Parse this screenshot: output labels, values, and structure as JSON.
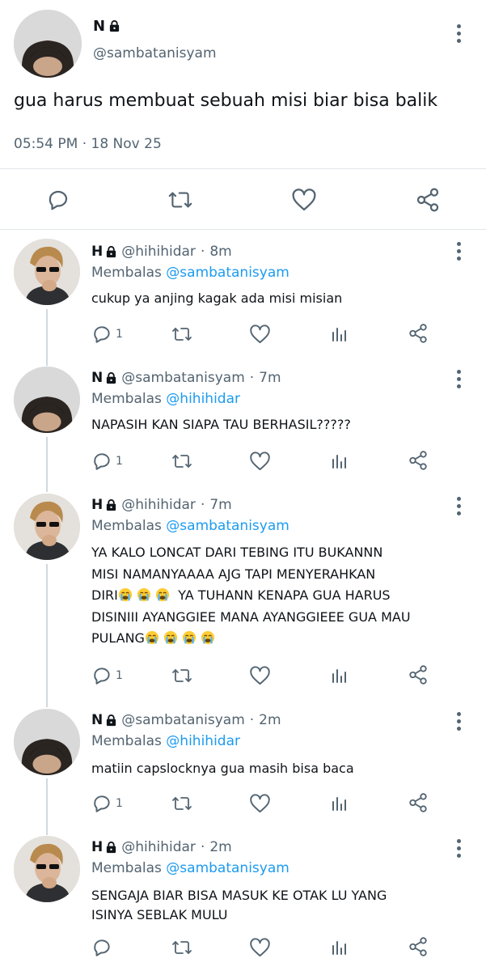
{
  "main": {
    "name": "N",
    "handle": "@sambatanisyam",
    "text": "gua harus membuat sebuah misi biar bisa balik",
    "timestamp": "05:54 PM · 18 Nov 25"
  },
  "replies": [
    {
      "name": "H",
      "handle": "@hihihidar",
      "time": "8m",
      "replying_label": "Membalas ",
      "replying_to": "@sambatanisyam",
      "text": "cukup ya anjing kagak ada misi misian",
      "reply_count": "1"
    },
    {
      "name": "N",
      "handle": "@sambatanisyam",
      "time": "7m",
      "replying_label": "Membalas ",
      "replying_to": "@hihihidar",
      "text": "NAPASIH KAN SIAPA TAU BERHASIL?????",
      "reply_count": "1"
    },
    {
      "name": "H",
      "handle": "@hihihidar",
      "time": "7m",
      "replying_label": "Membalas ",
      "replying_to": "@sambatanisyam",
      "text_lines": [
        "YA KALO LONCAT DARI TEBING ITU BUKANNN",
        "MISI NAMANYAAAA AJG TAPI MENYERAHKAN",
        "DIRI",
        "  YA TUHANN KENAPA GUA HARUS",
        "DISINIII AYANGGIEE MANA AYANGGIEEE GUA MAU",
        "PULANG"
      ],
      "reply_count": "1"
    },
    {
      "name": "N",
      "handle": "@sambatanisyam",
      "time": "2m",
      "replying_label": "Membalas ",
      "replying_to": "@hihihidar",
      "text": "matiin capslocknya gua masih bisa baca",
      "reply_count": "1"
    },
    {
      "name": "H",
      "handle": "@hihihidar",
      "time": "2m",
      "replying_label": "Membalas ",
      "replying_to": "@sambatanisyam",
      "text_lines": [
        "SENGAJA BIAR BISA MASUK KE OTAK LU YANG",
        "ISINYA SEBLAK MULU"
      ],
      "reply_count": ""
    }
  ],
  "colors": {
    "link": "#1d9bf0",
    "muted": "#536471",
    "divider": "#e1e6ea",
    "thread": "#cfd9de"
  }
}
